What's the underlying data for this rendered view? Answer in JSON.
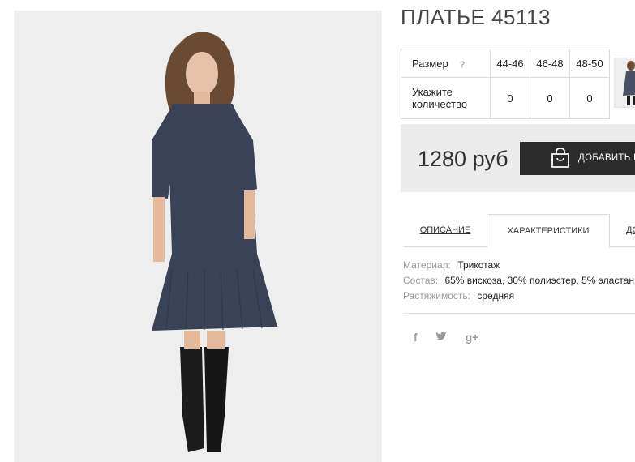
{
  "product": {
    "title": "ПЛАТЬЕ 45113",
    "photo_alt": "Платье 45113"
  },
  "size_table": {
    "size_label": "Размер",
    "help_icon": "?",
    "sizes": [
      "44-46",
      "46-48",
      "48-50"
    ],
    "qty_label_line1": "Укажите",
    "qty_label_line2": "количество",
    "quantities": [
      "0",
      "0",
      "0"
    ]
  },
  "price_block": {
    "price": "1280 руб",
    "buy_label": "ДОБАВИТЬ В"
  },
  "tabs": [
    {
      "label": "ОПИСАНИЕ"
    },
    {
      "label": "ХАРАКТЕРИСТИКИ"
    },
    {
      "label": "ДО"
    }
  ],
  "characteristics": [
    {
      "key": "Материал:",
      "value": "Трикотаж"
    },
    {
      "key": "Состав:",
      "value": "65% вискоза, 30% полиэстер, 5% эластан"
    },
    {
      "key": "Растяжимость:",
      "value": "средняя"
    }
  ],
  "social": [
    {
      "icon": "facebook-icon",
      "glyph": "f"
    },
    {
      "icon": "twitter-icon",
      "glyph": "t"
    },
    {
      "icon": "google-plus-icon",
      "glyph": "g+"
    }
  ],
  "colors": {
    "dress": "#3a4256",
    "button": "#2b2b2b",
    "price_bg": "#ececec"
  }
}
